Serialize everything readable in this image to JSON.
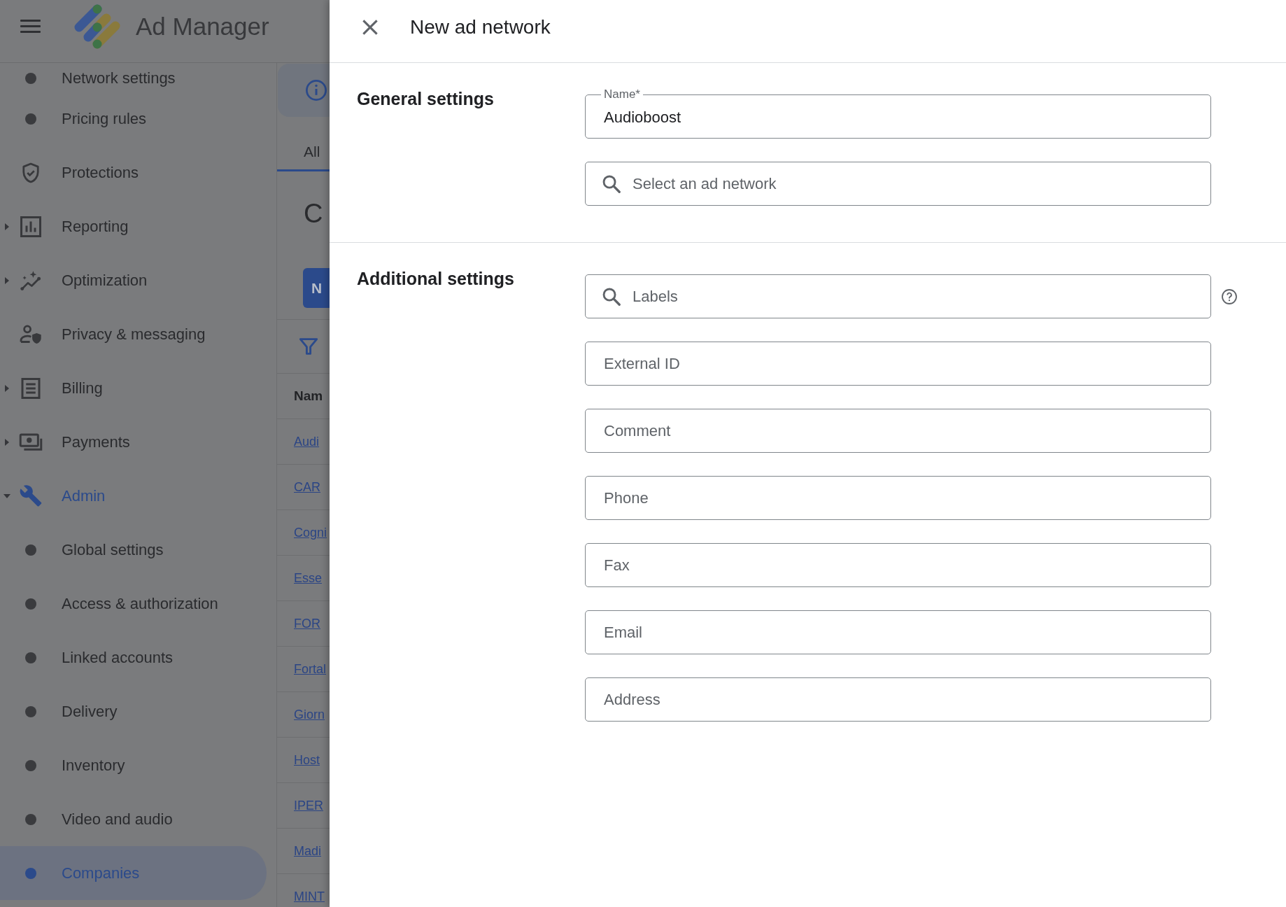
{
  "app_bar": {
    "title": "Ad Manager"
  },
  "sidebar": {
    "overflow_children": [
      {
        "label": "Network settings",
        "selected": false
      },
      {
        "label": "Pricing rules",
        "selected": false
      }
    ],
    "items": [
      {
        "label": "Protections",
        "kind": "page",
        "selected": false
      },
      {
        "label": "Reporting",
        "kind": "group",
        "expanded": false,
        "selected": false
      },
      {
        "label": "Optimization",
        "kind": "group",
        "expanded": false,
        "selected": false
      },
      {
        "label": "Privacy & messaging",
        "kind": "page",
        "selected": false
      },
      {
        "label": "Billing",
        "kind": "group",
        "expanded": false,
        "selected": false
      },
      {
        "label": "Payments",
        "kind": "group",
        "expanded": false,
        "selected": false
      },
      {
        "label": "Admin",
        "kind": "group",
        "expanded": true,
        "selected": false,
        "children": [
          {
            "label": "Global settings",
            "selected": false
          },
          {
            "label": "Access & authorization",
            "selected": false
          },
          {
            "label": "Linked accounts",
            "selected": false
          },
          {
            "label": "Delivery",
            "selected": false
          },
          {
            "label": "Inventory",
            "selected": false
          },
          {
            "label": "Video and audio",
            "selected": false
          },
          {
            "label": "Companies",
            "selected": true
          }
        ]
      }
    ]
  },
  "main": {
    "tabs": [
      {
        "label": "All",
        "selected": true
      }
    ],
    "heading": "C",
    "primary_button": "N",
    "table": {
      "columns": [
        "Nam"
      ],
      "rows": [
        "Audi",
        "CAR",
        "Cogni",
        "Esse",
        "FOR",
        "Fortal",
        "Giorn",
        "Host",
        "IPER",
        "Madi",
        "MINT"
      ]
    }
  },
  "panel": {
    "title": "New ad network",
    "sections": [
      {
        "title": "General settings",
        "fields": [
          {
            "kind": "text",
            "label": "Name*",
            "value": "Audioboost"
          },
          {
            "kind": "search",
            "placeholder": "Select an ad network"
          }
        ]
      },
      {
        "title": "Additional settings",
        "fields": [
          {
            "kind": "search",
            "placeholder": "Labels",
            "help": true
          },
          {
            "kind": "text",
            "placeholder": "External ID"
          },
          {
            "kind": "text",
            "placeholder": "Comment"
          },
          {
            "kind": "text",
            "placeholder": "Phone"
          },
          {
            "kind": "text",
            "placeholder": "Fax"
          },
          {
            "kind": "text",
            "placeholder": "Email"
          },
          {
            "kind": "text",
            "placeholder": "Address"
          }
        ]
      }
    ]
  }
}
